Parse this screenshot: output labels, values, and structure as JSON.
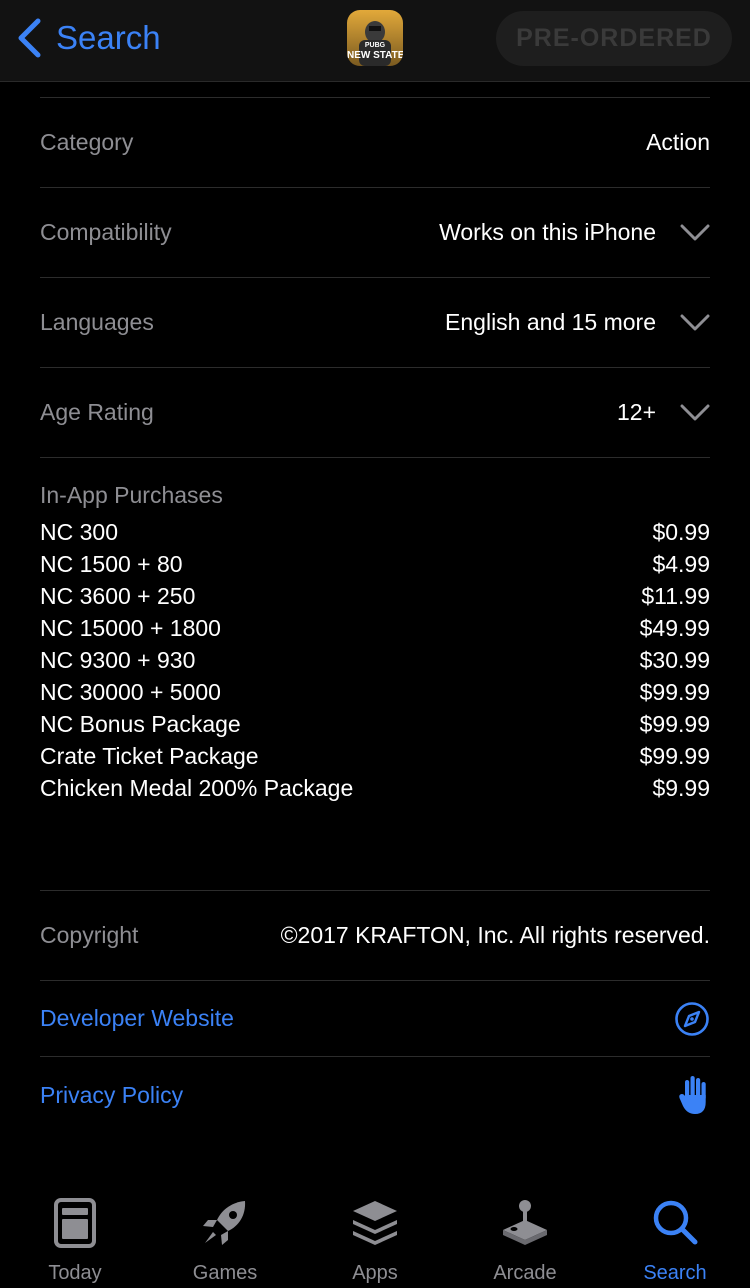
{
  "nav": {
    "back_label": "Search",
    "app_icon_text_top": "PUBG",
    "app_icon_text": "NEW STATE",
    "preorder_label": "PRE-ORDERED"
  },
  "info_rows": [
    {
      "label": "Category",
      "value": "Action"
    },
    {
      "label": "Compatibility",
      "value": "Works on this iPhone"
    },
    {
      "label": "Languages",
      "value": "English and 15 more"
    },
    {
      "label": "Age Rating",
      "value": "12+"
    }
  ],
  "iap": {
    "title": "In-App Purchases",
    "items": [
      {
        "name": "NC 300",
        "price": "$0.99"
      },
      {
        "name": "NC 1500 + 80",
        "price": "$4.99"
      },
      {
        "name": "NC 3600 + 250",
        "price": "$11.99"
      },
      {
        "name": "NC 15000 + 1800",
        "price": "$49.99"
      },
      {
        "name": "NC 9300 + 930",
        "price": "$30.99"
      },
      {
        "name": "NC 30000 + 5000",
        "price": "$99.99"
      },
      {
        "name": "NC Bonus Package",
        "price": "$99.99"
      },
      {
        "name": "Crate Ticket Package",
        "price": "$99.99"
      },
      {
        "name": "Chicken Medal 200% Package",
        "price": "$9.99"
      }
    ]
  },
  "copyright": {
    "label": "Copyright",
    "value": "©2017 KRAFTON, Inc. All rights reserved."
  },
  "links": {
    "developer_website": "Developer Website",
    "privacy_policy": "Privacy Policy"
  },
  "tabs": [
    {
      "label": "Today",
      "icon": "today-icon"
    },
    {
      "label": "Games",
      "icon": "rocket-icon"
    },
    {
      "label": "Apps",
      "icon": "layers-icon"
    },
    {
      "label": "Arcade",
      "icon": "joystick-icon"
    },
    {
      "label": "Search",
      "icon": "search-icon",
      "active": true
    }
  ],
  "colors": {
    "accent": "#3b82f6",
    "background": "#000000",
    "secondary_text": "#8e8e93"
  }
}
